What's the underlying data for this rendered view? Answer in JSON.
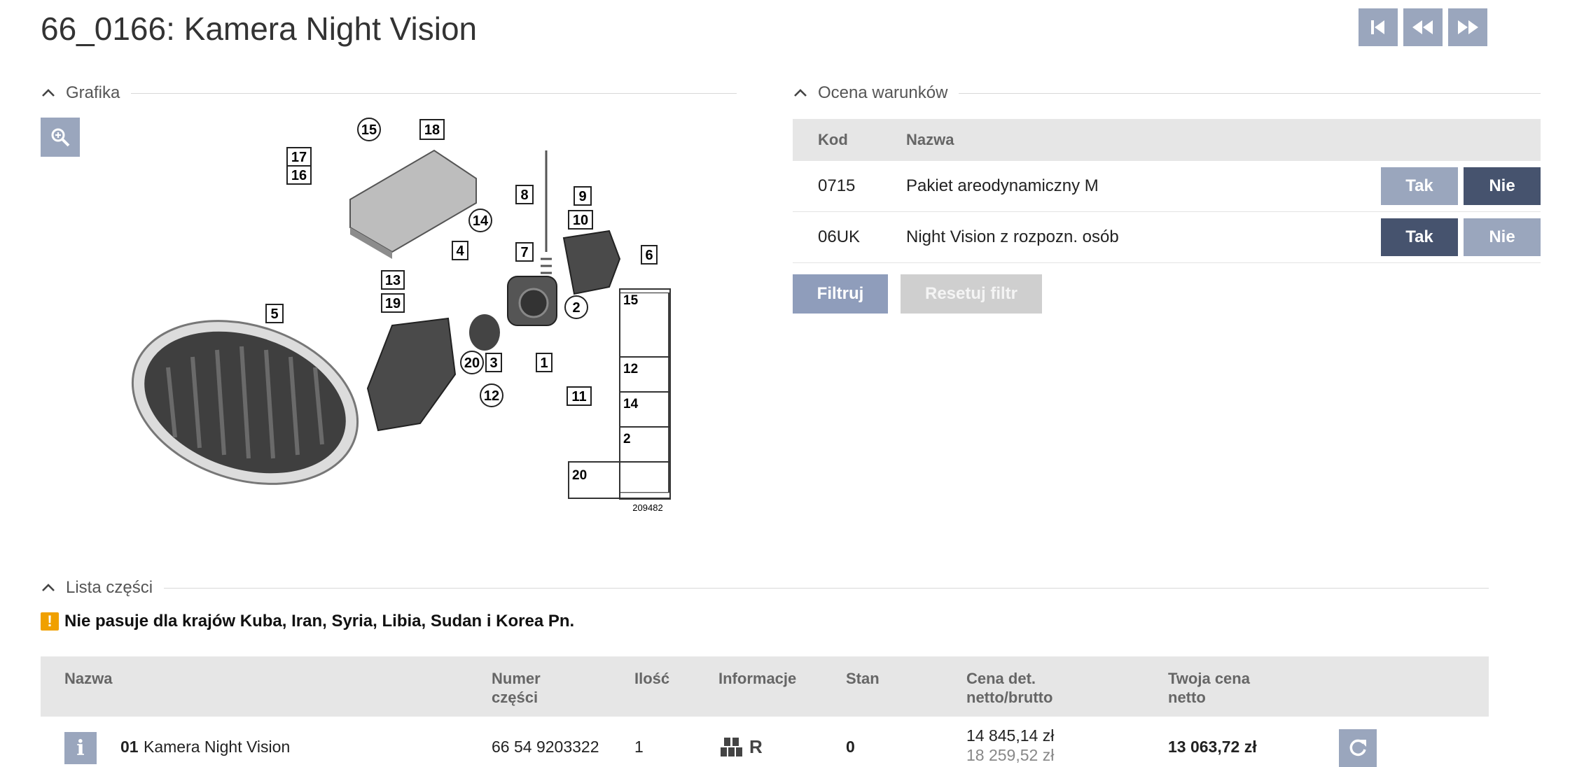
{
  "page": {
    "title": "66_0166: Kamera Night Vision"
  },
  "nav": {
    "first": "first-page-icon",
    "prev": "previous-icon",
    "next": "next-icon"
  },
  "sections": {
    "graphics": "Grafika",
    "conditions": "Ocena warunków",
    "parts": "Lista części"
  },
  "diagram": {
    "callouts": [
      "15",
      "18",
      "17",
      "16",
      "14",
      "13",
      "19",
      "5",
      "8",
      "9",
      "10",
      "7",
      "4",
      "6",
      "2",
      "1",
      "3",
      "20",
      "12",
      "11"
    ],
    "sidebar": [
      "15",
      "12",
      "14",
      "2",
      "20"
    ],
    "image_number": "209482"
  },
  "conditions": {
    "headers": {
      "code": "Kod",
      "name": "Nazwa"
    },
    "rows": [
      {
        "code": "0715",
        "name": "Pakiet areodynamiczny M",
        "yes": "Tak",
        "no": "Nie",
        "selected": "no"
      },
      {
        "code": "06UK",
        "name": "Night Vision z rozpozn. osób",
        "yes": "Tak",
        "no": "Nie",
        "selected": "yes"
      }
    ],
    "filter_label": "Filtruj",
    "reset_label": "Resetuj filtr"
  },
  "warning": {
    "text": "Nie pasuje dla krajów Kuba, Iran, Syria, Libia, Sudan i Korea Pn."
  },
  "parts": {
    "headers": {
      "name": "Nazwa",
      "number_l1": "Numer",
      "number_l2": "części",
      "qty": "Ilość",
      "info": "Informacje",
      "state": "Stan",
      "price_l1": "Cena det.",
      "price_l2": "netto/brutto",
      "your_l1": "Twoja cena",
      "your_l2": "netto"
    },
    "rows": [
      {
        "pos": "01",
        "name": "Kamera Night Vision",
        "number": "66 54 9203322",
        "qty": "1",
        "info_code": "R",
        "state": "0",
        "price_netto": "14 845,14 zł",
        "price_brutto": "18 259,52 zł",
        "your_price": "13 063,72 zł"
      }
    ]
  },
  "colors": {
    "button": "#9aa6bd",
    "button_dark": "#46536e",
    "warning": "#f0a000",
    "header_bg": "#e6e6e6"
  }
}
